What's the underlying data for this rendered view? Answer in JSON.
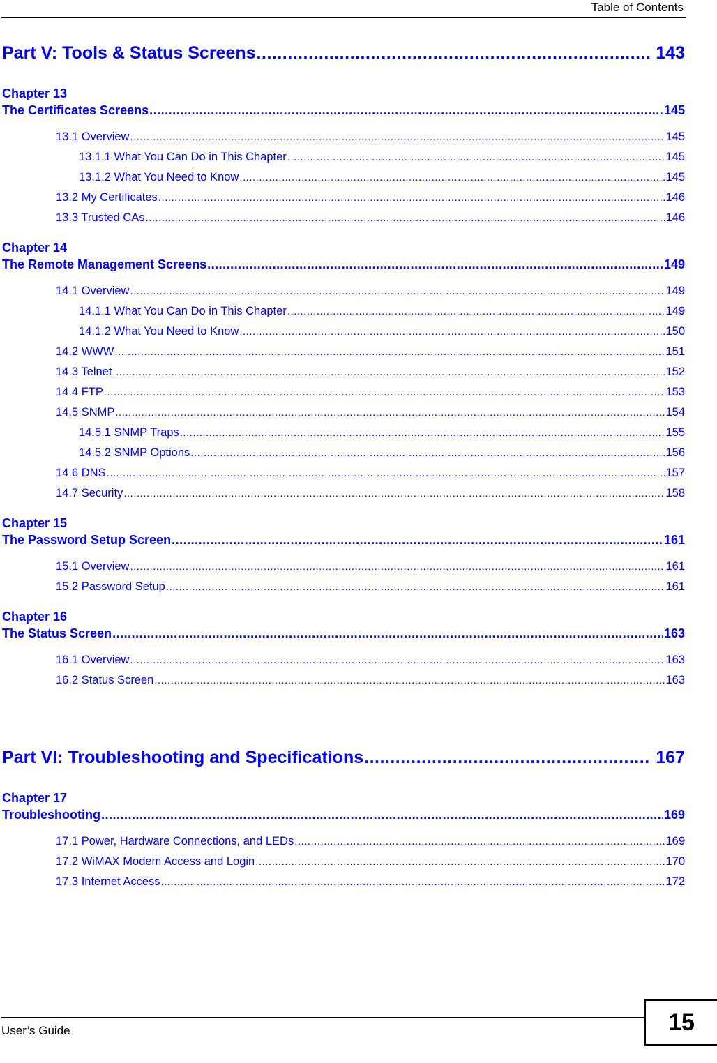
{
  "header": {
    "title": "Table of Contents"
  },
  "footer": {
    "guide_label": "User’s Guide",
    "page_number": "15"
  },
  "toc": {
    "leader_dots": "...................................................................................................................................................................................",
    "blocks": [
      {
        "type": "part",
        "label": "Part V: Tools & Status Screens",
        "page": "143"
      },
      {
        "type": "chapter",
        "number": "Chapter  13",
        "title": "The Certificates Screens",
        "page": "145",
        "sections": [
          {
            "level": 2,
            "label": "13.1 Overview",
            "page": "145"
          },
          {
            "level": 3,
            "label": "13.1.1 What You Can Do in This Chapter",
            "page": "145"
          },
          {
            "level": 3,
            "label": "13.1.2 What You Need to Know",
            "page": "145"
          },
          {
            "level": 2,
            "label": "13.2 My Certificates",
            "page": "146"
          },
          {
            "level": 2,
            "label": "13.3 Trusted CAs",
            "page": "146"
          }
        ]
      },
      {
        "type": "chapter",
        "number": "Chapter  14",
        "title": "The Remote Management Screens",
        "page": "149",
        "sections": [
          {
            "level": 2,
            "label": "14.1 Overview",
            "page": "149"
          },
          {
            "level": 3,
            "label": "14.1.1 What You Can Do in This Chapter",
            "page": "149"
          },
          {
            "level": 3,
            "label": "14.1.2 What You Need to Know",
            "page": "150"
          },
          {
            "level": 2,
            "label": "14.2 WWW",
            "page": "151"
          },
          {
            "level": 2,
            "label": "14.3 Telnet",
            "page": "152"
          },
          {
            "level": 2,
            "label": "14.4 FTP",
            "page": "153"
          },
          {
            "level": 2,
            "label": "14.5 SNMP",
            "page": "154"
          },
          {
            "level": 3,
            "label": "14.5.1 SNMP Traps",
            "page": "155"
          },
          {
            "level": 3,
            "label": "14.5.2 SNMP Options",
            "page": "156"
          },
          {
            "level": 2,
            "label": "14.6 DNS",
            "page": "157"
          },
          {
            "level": 2,
            "label": "14.7 Security",
            "page": "158"
          }
        ]
      },
      {
        "type": "chapter",
        "number": "Chapter  15",
        "title": "The Password Setup Screen",
        "page": "161",
        "sections": [
          {
            "level": 2,
            "label": "15.1 Overview",
            "page": "161"
          },
          {
            "level": 2,
            "label": "15.2 Password Setup",
            "page": "161"
          }
        ]
      },
      {
        "type": "chapter",
        "number": "Chapter  16",
        "title": "The Status Screen",
        "page": "163",
        "sections": [
          {
            "level": 2,
            "label": "16.1 Overview",
            "page": "163"
          },
          {
            "level": 2,
            "label": "16.2 Status Screen",
            "page": "163"
          }
        ]
      },
      {
        "type": "gap"
      },
      {
        "type": "part",
        "label": "Part VI: Troubleshooting and Specifications",
        "page": "167"
      },
      {
        "type": "chapter",
        "number": "Chapter  17",
        "title": "Troubleshooting",
        "page": "169",
        "sections": [
          {
            "level": 2,
            "label": "17.1 Power, Hardware Connections, and LEDs",
            "page": "169"
          },
          {
            "level": 2,
            "label": "17.2 WiMAX Modem Access and Login",
            "page": "170"
          },
          {
            "level": 2,
            "label": "17.3 Internet Access",
            "page": "172"
          }
        ]
      }
    ]
  },
  "colors": {
    "link_blue": "#0000ff",
    "text_black": "#000000"
  }
}
